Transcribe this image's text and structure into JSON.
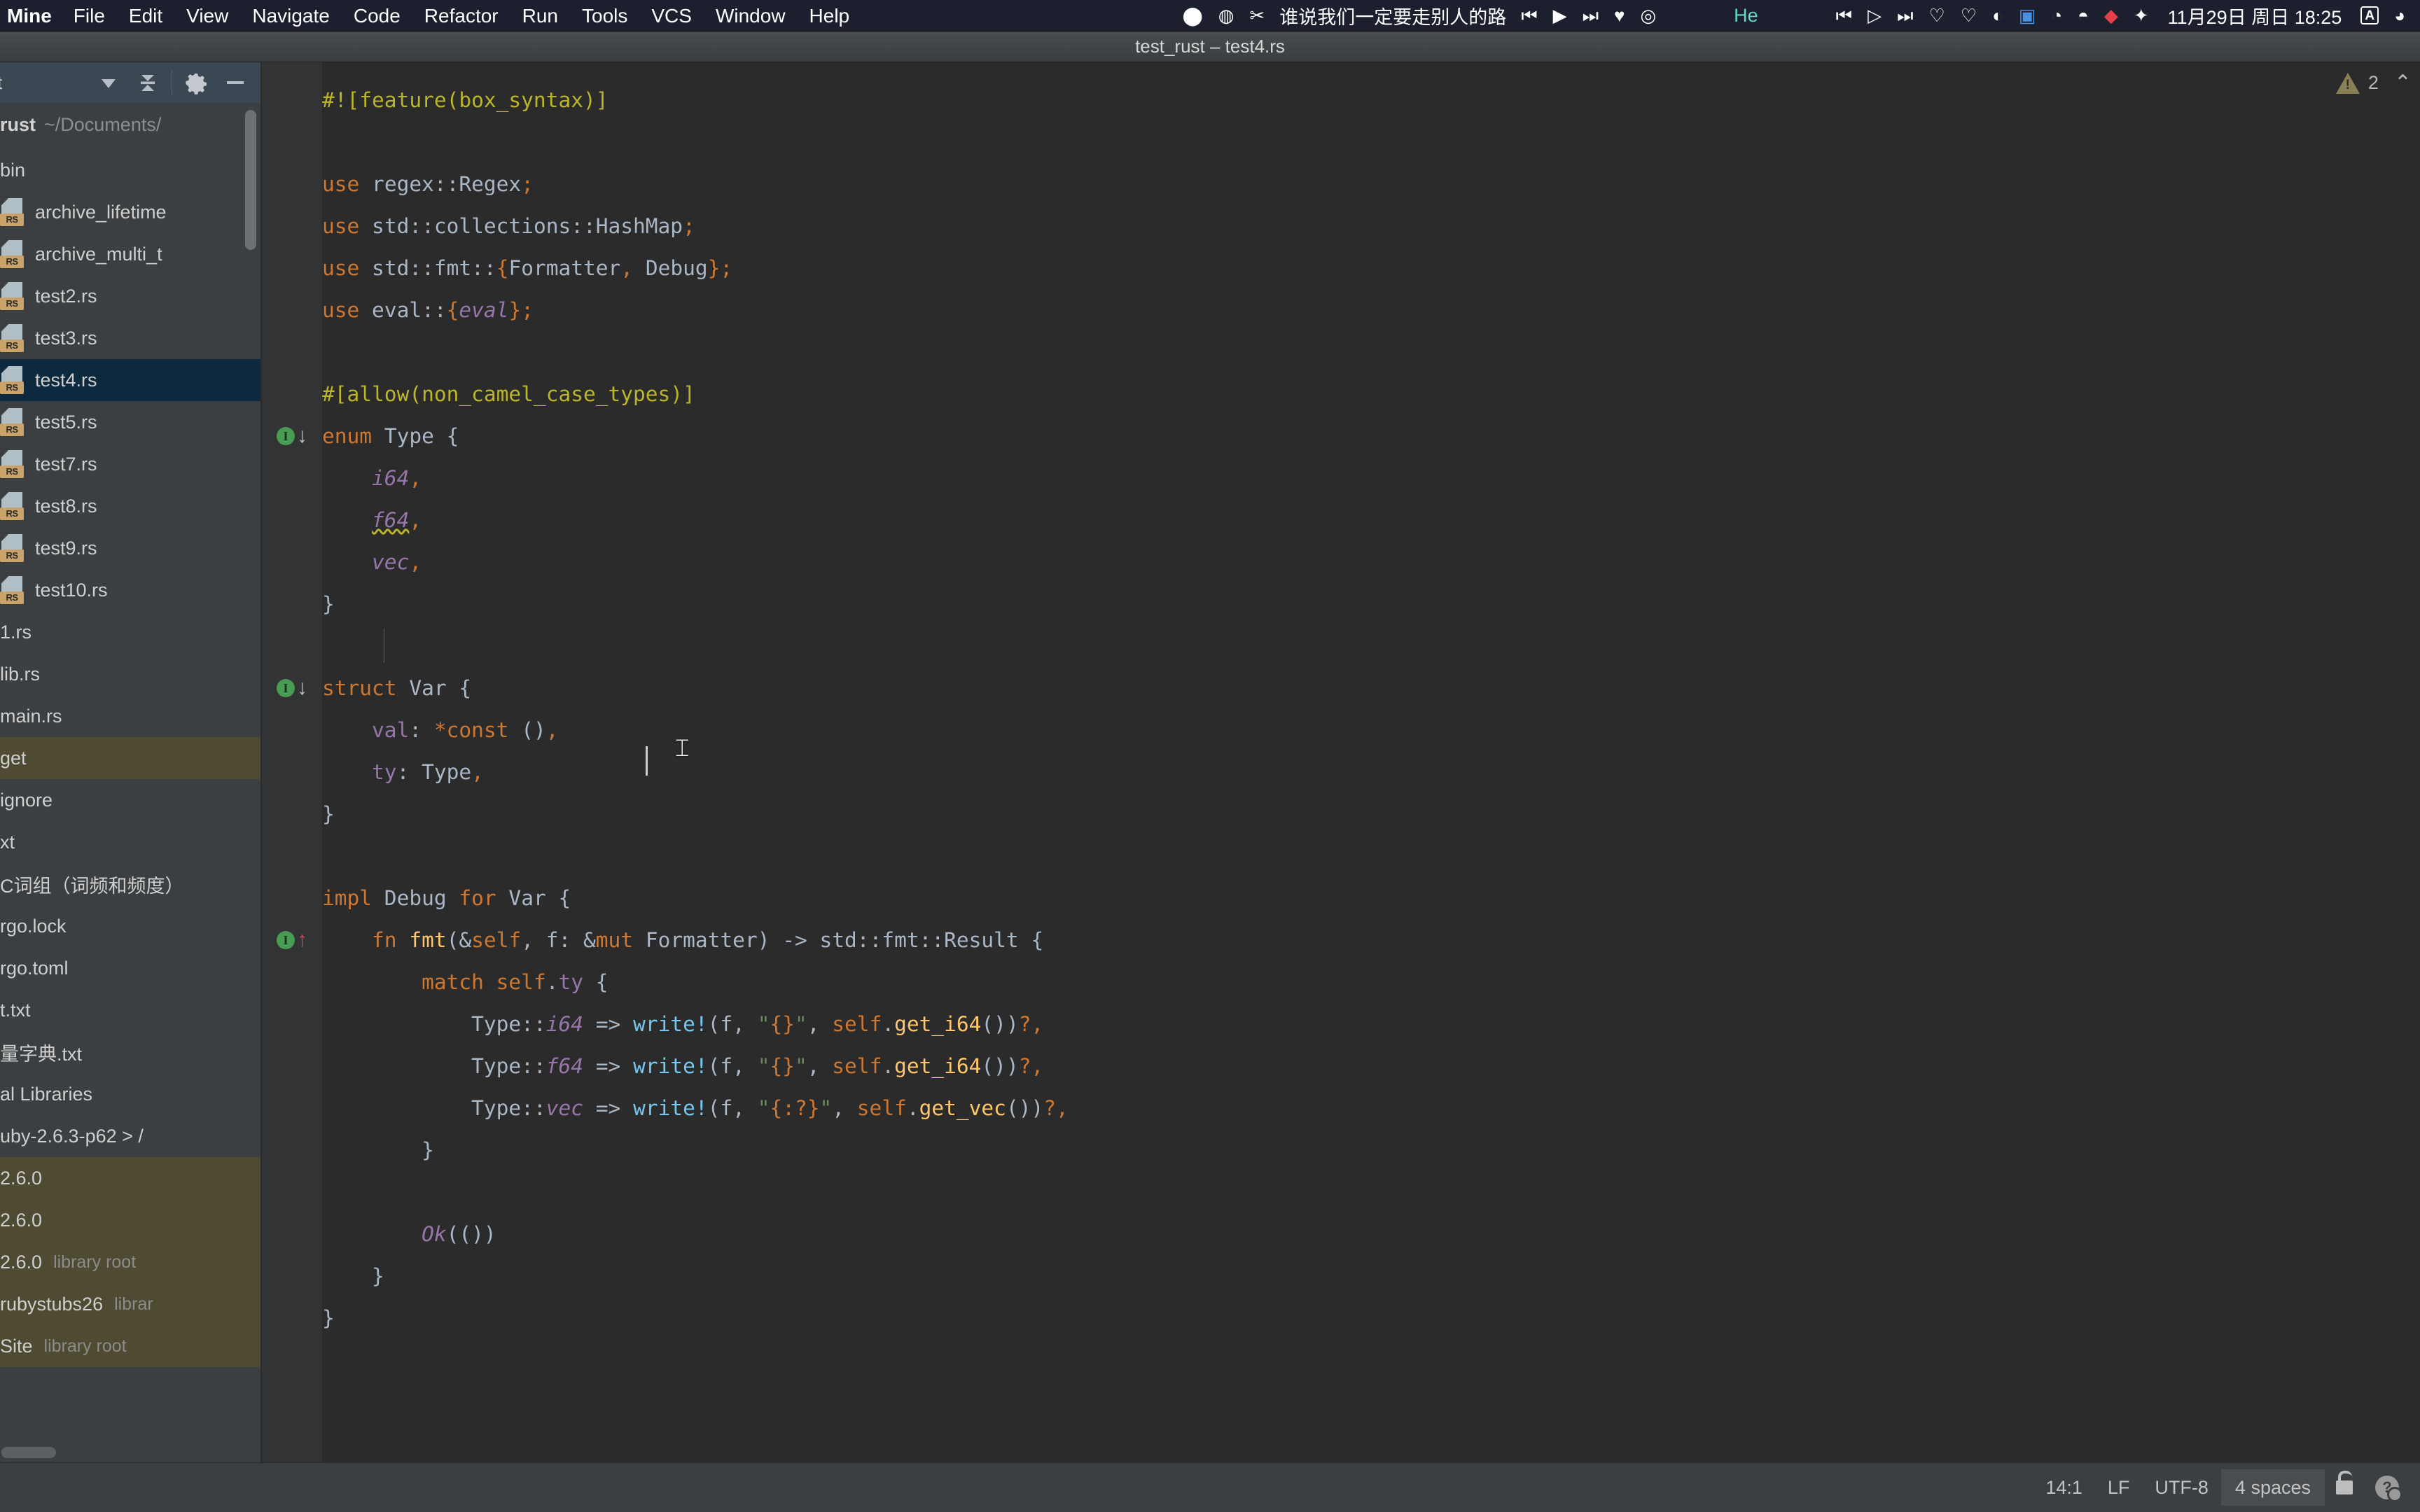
{
  "menubar": {
    "app_name": "Mine",
    "items": [
      "File",
      "Edit",
      "View",
      "Navigate",
      "Code",
      "Refactor",
      "Run",
      "Tools",
      "VCS",
      "Window",
      "Help"
    ],
    "player": {
      "record_icon": "record-icon",
      "compass_icon": "compass-icon",
      "scissors_icon": "scissors-icon",
      "song_title": "谁说我们一定要走别人的路",
      "prev_icon": "previous-track-icon",
      "play_icon": "play-icon",
      "next_icon": "next-track-icon",
      "heart_icon": "heart-icon",
      "spiral_icon": "netease-music-icon"
    },
    "he_label": "He",
    "tray": {
      "prev_icon": "previous-track-icon",
      "play_icon": "play-icon",
      "next_icon": "next-track-icon",
      "heart_outline_icon": "heart-outline-icon",
      "heart_slash_icon": "heart-slash-icon",
      "flame_icon": "flame-icon",
      "bluetooth_icon": "bluetooth-share-icon",
      "elephant_icon": "evernote-icon",
      "drop_icon": "drop-icon",
      "book_icon": "red-book-icon",
      "bird_icon": "bird-icon",
      "datetime": "11月29日 周日 18:25",
      "input_source": "A",
      "control_center_icon": "control-center-icon"
    }
  },
  "window": {
    "title": "test_rust – test4.rs"
  },
  "project_panel": {
    "header_label": "t",
    "icons": {
      "dropdown": "chevron-down-icon",
      "collapse_all": "collapse-all-icon",
      "settings": "gear-icon",
      "hide": "minimize-icon"
    },
    "root_name": "rust",
    "root_path": "~/Documents/",
    "tree": [
      {
        "label": "bin",
        "icon": "none",
        "state": "normal"
      },
      {
        "label": "archive_lifetime",
        "icon": "rs-file",
        "state": "normal"
      },
      {
        "label": "archive_multi_t",
        "icon": "rs-file",
        "state": "normal"
      },
      {
        "label": "test2.rs",
        "icon": "rs-file",
        "state": "normal"
      },
      {
        "label": "test3.rs",
        "icon": "rs-file",
        "state": "normal"
      },
      {
        "label": "test4.rs",
        "icon": "rs-file",
        "state": "selected"
      },
      {
        "label": "test5.rs",
        "icon": "rs-file",
        "state": "normal"
      },
      {
        "label": "test7.rs",
        "icon": "rs-file",
        "state": "normal"
      },
      {
        "label": "test8.rs",
        "icon": "rs-file",
        "state": "normal"
      },
      {
        "label": "test9.rs",
        "icon": "rs-file",
        "state": "normal"
      },
      {
        "label": "test10.rs",
        "icon": "rs-file",
        "state": "normal"
      },
      {
        "label": "1.rs",
        "icon": "none",
        "state": "normal"
      },
      {
        "label": "lib.rs",
        "icon": "none",
        "state": "normal"
      },
      {
        "label": "main.rs",
        "icon": "none",
        "state": "normal"
      },
      {
        "label": "get",
        "icon": "none",
        "state": "excluded"
      },
      {
        "label": "ignore",
        "icon": "none",
        "state": "normal"
      },
      {
        "label": "xt",
        "icon": "none",
        "state": "normal"
      },
      {
        "label": "C词组（词频和频度）",
        "icon": "none",
        "state": "normal"
      },
      {
        "label": "rgo.lock",
        "icon": "none",
        "state": "normal"
      },
      {
        "label": "rgo.toml",
        "icon": "none",
        "state": "normal"
      },
      {
        "label": "t.txt",
        "icon": "none",
        "state": "normal"
      },
      {
        "label": "量字典.txt",
        "icon": "none",
        "state": "normal"
      },
      {
        "label": "al Libraries",
        "icon": "none",
        "state": "normal"
      },
      {
        "label": "uby-2.6.3-p62 > /",
        "icon": "none",
        "state": "normal"
      },
      {
        "label": "2.6.0",
        "icon": "none",
        "state": "excluded"
      },
      {
        "label": "2.6.0",
        "icon": "none",
        "state": "excluded"
      },
      {
        "label": "2.6.0",
        "icon": "none",
        "state": "excluded",
        "sub": "library root"
      },
      {
        "label": "rubystubs26",
        "icon": "none",
        "state": "excluded",
        "sub": "librar"
      },
      {
        "label": "Site",
        "icon": "none",
        "state": "excluded",
        "sub": "library root"
      }
    ]
  },
  "editor": {
    "warnings": {
      "icon": "warning-triangle-icon",
      "count": "2",
      "collapse_icon": "chevron-up-icon"
    },
    "gutter_markers": [
      {
        "line": 9,
        "icon": "implemented-down-icon",
        "glyph": "I",
        "arrow": "down"
      },
      {
        "line": 15,
        "icon": "implemented-down-icon",
        "glyph": "I",
        "arrow": "down"
      },
      {
        "line": 21,
        "icon": "implementing-up-icon",
        "glyph": "I",
        "arrow": "up"
      }
    ],
    "lines": [
      [
        {
          "t": "#![feature(box_syntax)]",
          "c": "attr"
        }
      ],
      [],
      [
        {
          "t": "use",
          "c": "k"
        },
        {
          "t": " regex::Regex",
          "c": "id"
        },
        {
          "t": ";",
          "c": "k"
        }
      ],
      [
        {
          "t": "use",
          "c": "k"
        },
        {
          "t": " std::collections::HashMap",
          "c": "id"
        },
        {
          "t": ";",
          "c": "k"
        }
      ],
      [
        {
          "t": "use",
          "c": "k"
        },
        {
          "t": " std::fmt::",
          "c": "id"
        },
        {
          "t": "{",
          "c": "k"
        },
        {
          "t": "Formatter",
          "c": "id"
        },
        {
          "t": ",",
          "c": "k"
        },
        {
          "t": " Debug",
          "c": "id"
        },
        {
          "t": "}",
          "c": "k"
        },
        {
          "t": ";",
          "c": "k"
        }
      ],
      [
        {
          "t": "use",
          "c": "k"
        },
        {
          "t": " eval::",
          "c": "id"
        },
        {
          "t": "{",
          "c": "k"
        },
        {
          "t": "eval",
          "c": "en"
        },
        {
          "t": "}",
          "c": "k"
        },
        {
          "t": ";",
          "c": "k"
        }
      ],
      [],
      [
        {
          "t": "#[allow(non_camel_case_types)]",
          "c": "attr"
        }
      ],
      [
        {
          "t": "enum",
          "c": "k"
        },
        {
          "t": " Type ",
          "c": "ty"
        },
        {
          "t": "{",
          "c": "p"
        }
      ],
      [
        {
          "t": "    ",
          "c": "p"
        },
        {
          "t": "i64",
          "c": "en"
        },
        {
          "t": ",",
          "c": "k"
        }
      ],
      [
        {
          "t": "    ",
          "c": "p"
        },
        {
          "t": "f64",
          "c": "en squig"
        },
        {
          "t": ",",
          "c": "k"
        }
      ],
      [
        {
          "t": "    ",
          "c": "p"
        },
        {
          "t": "vec",
          "c": "en"
        },
        {
          "t": ",",
          "c": "k"
        }
      ],
      [
        {
          "t": "}",
          "c": "p"
        }
      ],
      [],
      [
        {
          "t": "struct",
          "c": "k"
        },
        {
          "t": " Var ",
          "c": "ty"
        },
        {
          "t": "{",
          "c": "p"
        }
      ],
      [
        {
          "t": "    ",
          "c": "p"
        },
        {
          "t": "val",
          "c": "fld"
        },
        {
          "t": ": ",
          "c": "p"
        },
        {
          "t": "*const",
          "c": "k"
        },
        {
          "t": " ()",
          "c": "p"
        },
        {
          "t": ",",
          "c": "k"
        }
      ],
      [
        {
          "t": "    ",
          "c": "p"
        },
        {
          "t": "ty",
          "c": "fld"
        },
        {
          "t": ": Type",
          "c": "p"
        },
        {
          "t": ",",
          "c": "k"
        }
      ],
      [
        {
          "t": "}",
          "c": "p"
        }
      ],
      [],
      [
        {
          "t": "impl",
          "c": "k"
        },
        {
          "t": " Debug ",
          "c": "ty"
        },
        {
          "t": "for",
          "c": "k"
        },
        {
          "t": " Var ",
          "c": "ty"
        },
        {
          "t": "{",
          "c": "p"
        }
      ],
      [
        {
          "t": "    ",
          "c": "p"
        },
        {
          "t": "fn",
          "c": "k"
        },
        {
          "t": " ",
          "c": "p"
        },
        {
          "t": "fmt",
          "c": "fn"
        },
        {
          "t": "(&",
          "c": "p"
        },
        {
          "t": "self",
          "c": "k"
        },
        {
          "t": ", f: &",
          "c": "p"
        },
        {
          "t": "mut",
          "c": "k"
        },
        {
          "t": " Formatter) -> std::fmt::Result ",
          "c": "p"
        },
        {
          "t": "{",
          "c": "p"
        }
      ],
      [
        {
          "t": "        ",
          "c": "p"
        },
        {
          "t": "match",
          "c": "k"
        },
        {
          "t": " ",
          "c": "p"
        },
        {
          "t": "self",
          "c": "k"
        },
        {
          "t": ".",
          "c": "p"
        },
        {
          "t": "ty",
          "c": "fld"
        },
        {
          "t": " {",
          "c": "p"
        }
      ],
      [
        {
          "t": "            ",
          "c": "p"
        },
        {
          "t": "Type::",
          "c": "p"
        },
        {
          "t": "i64",
          "c": "en"
        },
        {
          "t": " => ",
          "c": "p"
        },
        {
          "t": "write!",
          "c": "mac"
        },
        {
          "t": "(f, ",
          "c": "p"
        },
        {
          "t": "\"",
          "c": "str"
        },
        {
          "t": "{}",
          "c": "fmt"
        },
        {
          "t": "\"",
          "c": "str"
        },
        {
          "t": ", ",
          "c": "p"
        },
        {
          "t": "self",
          "c": "k"
        },
        {
          "t": ".",
          "c": "p"
        },
        {
          "t": "get_i64",
          "c": "fn"
        },
        {
          "t": "())",
          "c": "p"
        },
        {
          "t": "?",
          "c": "k"
        },
        {
          "t": ",",
          "c": "k"
        }
      ],
      [
        {
          "t": "            ",
          "c": "p"
        },
        {
          "t": "Type::",
          "c": "p"
        },
        {
          "t": "f64",
          "c": "en"
        },
        {
          "t": " => ",
          "c": "p"
        },
        {
          "t": "write!",
          "c": "mac"
        },
        {
          "t": "(f, ",
          "c": "p"
        },
        {
          "t": "\"",
          "c": "str"
        },
        {
          "t": "{}",
          "c": "fmt"
        },
        {
          "t": "\"",
          "c": "str"
        },
        {
          "t": ", ",
          "c": "p"
        },
        {
          "t": "self",
          "c": "k"
        },
        {
          "t": ".",
          "c": "p"
        },
        {
          "t": "get_i64",
          "c": "fn"
        },
        {
          "t": "())",
          "c": "p"
        },
        {
          "t": "?",
          "c": "k"
        },
        {
          "t": ",",
          "c": "k"
        }
      ],
      [
        {
          "t": "            ",
          "c": "p"
        },
        {
          "t": "Type::",
          "c": "p"
        },
        {
          "t": "vec",
          "c": "en"
        },
        {
          "t": " => ",
          "c": "p"
        },
        {
          "t": "write!",
          "c": "mac"
        },
        {
          "t": "(f, ",
          "c": "p"
        },
        {
          "t": "\"",
          "c": "str"
        },
        {
          "t": "{:?}",
          "c": "fmt"
        },
        {
          "t": "\"",
          "c": "str"
        },
        {
          "t": ", ",
          "c": "p"
        },
        {
          "t": "self",
          "c": "k"
        },
        {
          "t": ".",
          "c": "p"
        },
        {
          "t": "get_vec",
          "c": "fn"
        },
        {
          "t": "())",
          "c": "p"
        },
        {
          "t": "?",
          "c": "k"
        },
        {
          "t": ",",
          "c": "k"
        }
      ],
      [
        {
          "t": "        }",
          "c": "p"
        }
      ],
      [],
      [
        {
          "t": "        ",
          "c": "p"
        },
        {
          "t": "Ok",
          "c": "en"
        },
        {
          "t": "(())",
          "c": "p"
        }
      ],
      [
        {
          "t": "    }",
          "c": "p"
        }
      ],
      [
        {
          "t": "}",
          "c": "p"
        }
      ]
    ]
  },
  "statusbar": {
    "caret_position": "14:1",
    "line_separator": "LF",
    "encoding": "UTF-8",
    "indent": "4 spaces",
    "lock_icon": "lock-open-icon",
    "help_icon": "help-settings-icon"
  }
}
